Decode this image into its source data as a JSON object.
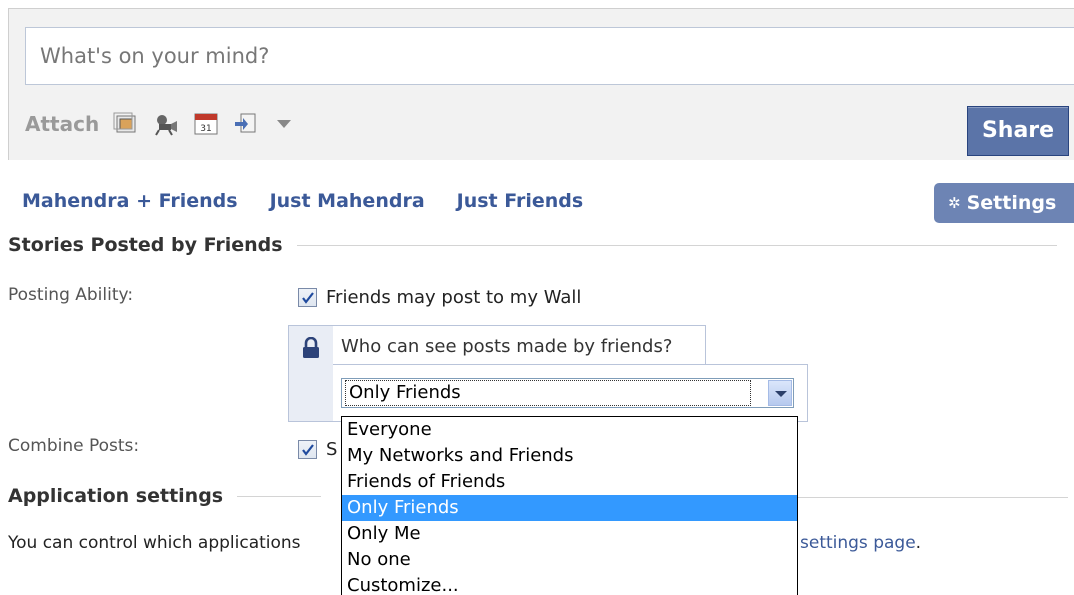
{
  "composer": {
    "placeholder": "What's on your mind?",
    "attach_label": "Attach",
    "attach_icons": [
      "photo-icon",
      "video-icon",
      "event-icon",
      "link-icon"
    ],
    "share_label": "Share"
  },
  "filters": {
    "tabs": [
      "Mahendra + Friends",
      "Just Mahendra",
      "Just Friends"
    ],
    "settings_label": "Settings"
  },
  "stories_section": {
    "title": "Stories Posted by Friends",
    "posting_ability_label": "Posting Ability:",
    "posting_checkbox_label": "Friends may post to my Wall",
    "posting_checked": true,
    "privacy_question": "Who can see posts made by friends?",
    "privacy_selected": "Only Friends",
    "combine_posts_label": "Combine Posts:",
    "combine_checkbox_label": "S",
    "combine_checked": true
  },
  "privacy_dropdown": {
    "options": [
      "Everyone",
      "My Networks and Friends",
      "Friends of Friends",
      "Only Friends",
      "Only Me",
      "No one",
      "Customize..."
    ],
    "highlighted": "Only Friends"
  },
  "application_section": {
    "title": "Application settings",
    "description_start": "You can control which applications",
    "link_text": "settings page",
    "description_end": "."
  },
  "colors": {
    "link": "#3b5998",
    "share_button": "#5b74a8",
    "settings_button": "#6d84b4",
    "dropdown_highlight": "#3399ff"
  }
}
